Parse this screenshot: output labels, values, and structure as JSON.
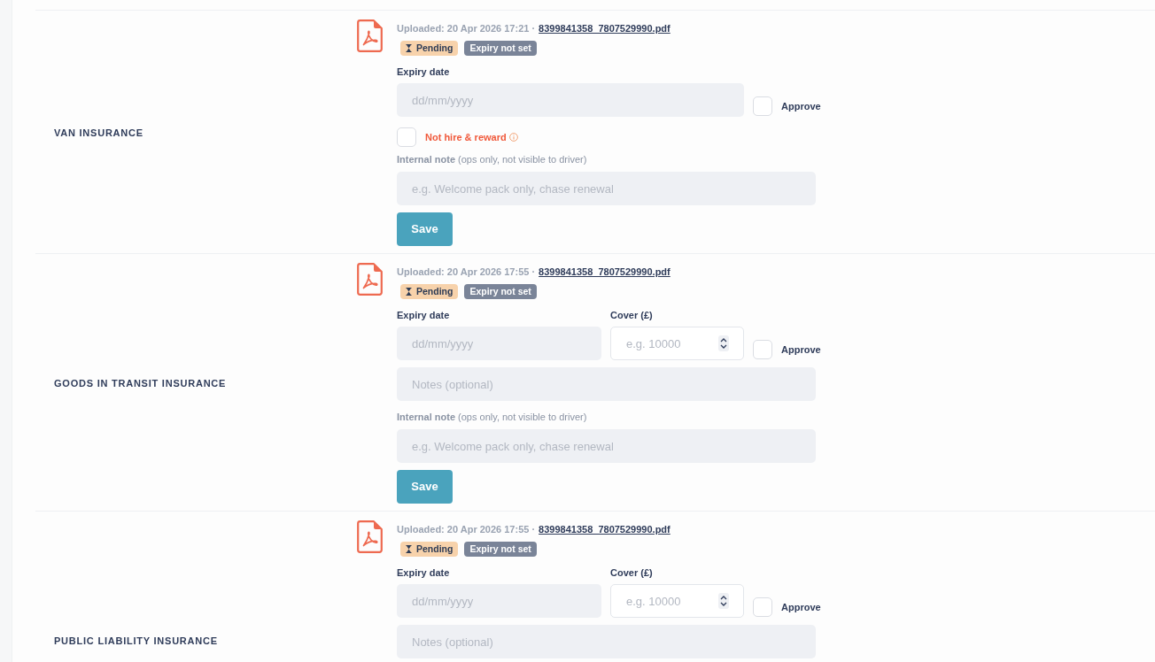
{
  "rows": [
    {
      "title": "VAN INSURANCE",
      "uploaded": "Uploaded: 20 Apr 2026 17:21 ·",
      "file": "8399841358_7807529990.pdf",
      "badges": [
        {
          "kind": "status",
          "text": "Pending"
        },
        {
          "kind": "expiry",
          "text": "Expiry not set"
        }
      ],
      "expiry": {
        "label": "Expiry date",
        "placeholder": "dd/mm/yyyy"
      },
      "approve": {
        "label": "Approve",
        "checked": false
      },
      "hire_reward": {
        "label": "Not hire & reward",
        "checked": false
      },
      "internal_note": {
        "label": "**Internal note** (ops only, not visible to driver)",
        "placeholder": "e.g. Welcome pack only, chase renewal"
      },
      "save": "Save"
    },
    {
      "title": "GOODS IN TRANSIT INSURANCE",
      "uploaded": "Uploaded: 20 Apr 2026 17:55 ·",
      "file": "8399841358_7807529990.pdf",
      "badges": [
        {
          "kind": "status",
          "text": "Pending"
        },
        {
          "kind": "expiry",
          "text": "Expiry not set"
        }
      ],
      "expiry": {
        "label": "Expiry date",
        "placeholder": "dd/mm/yyyy"
      },
      "cover": {
        "label": "Cover (£)",
        "placeholder": "e.g. 10000"
      },
      "approve": {
        "label": "Approve",
        "checked": false
      },
      "notes": {
        "placeholder": "Notes (optional)"
      },
      "internal_note": {
        "label": "**Internal note** (ops only, not visible to driver)",
        "placeholder": "e.g. Welcome pack only, chase renewal"
      },
      "save": "Save"
    },
    {
      "title": "PUBLIC LIABILITY INSURANCE",
      "uploaded": "Uploaded: 20 Apr 2026 17:55 ·",
      "file": "8399841358_7807529990.pdf",
      "badges": [
        {
          "kind": "status",
          "text": "Pending"
        },
        {
          "kind": "expiry",
          "text": "Expiry not set"
        }
      ],
      "expiry": {
        "label": "Expiry date",
        "placeholder": "dd/mm/yyyy"
      },
      "cover": {
        "label": "Cover (£)",
        "placeholder": "e.g. 10000"
      },
      "approve": {
        "label": "Approve",
        "checked": false
      },
      "notes": {
        "placeholder": "Notes (optional)"
      }
    }
  ]
}
